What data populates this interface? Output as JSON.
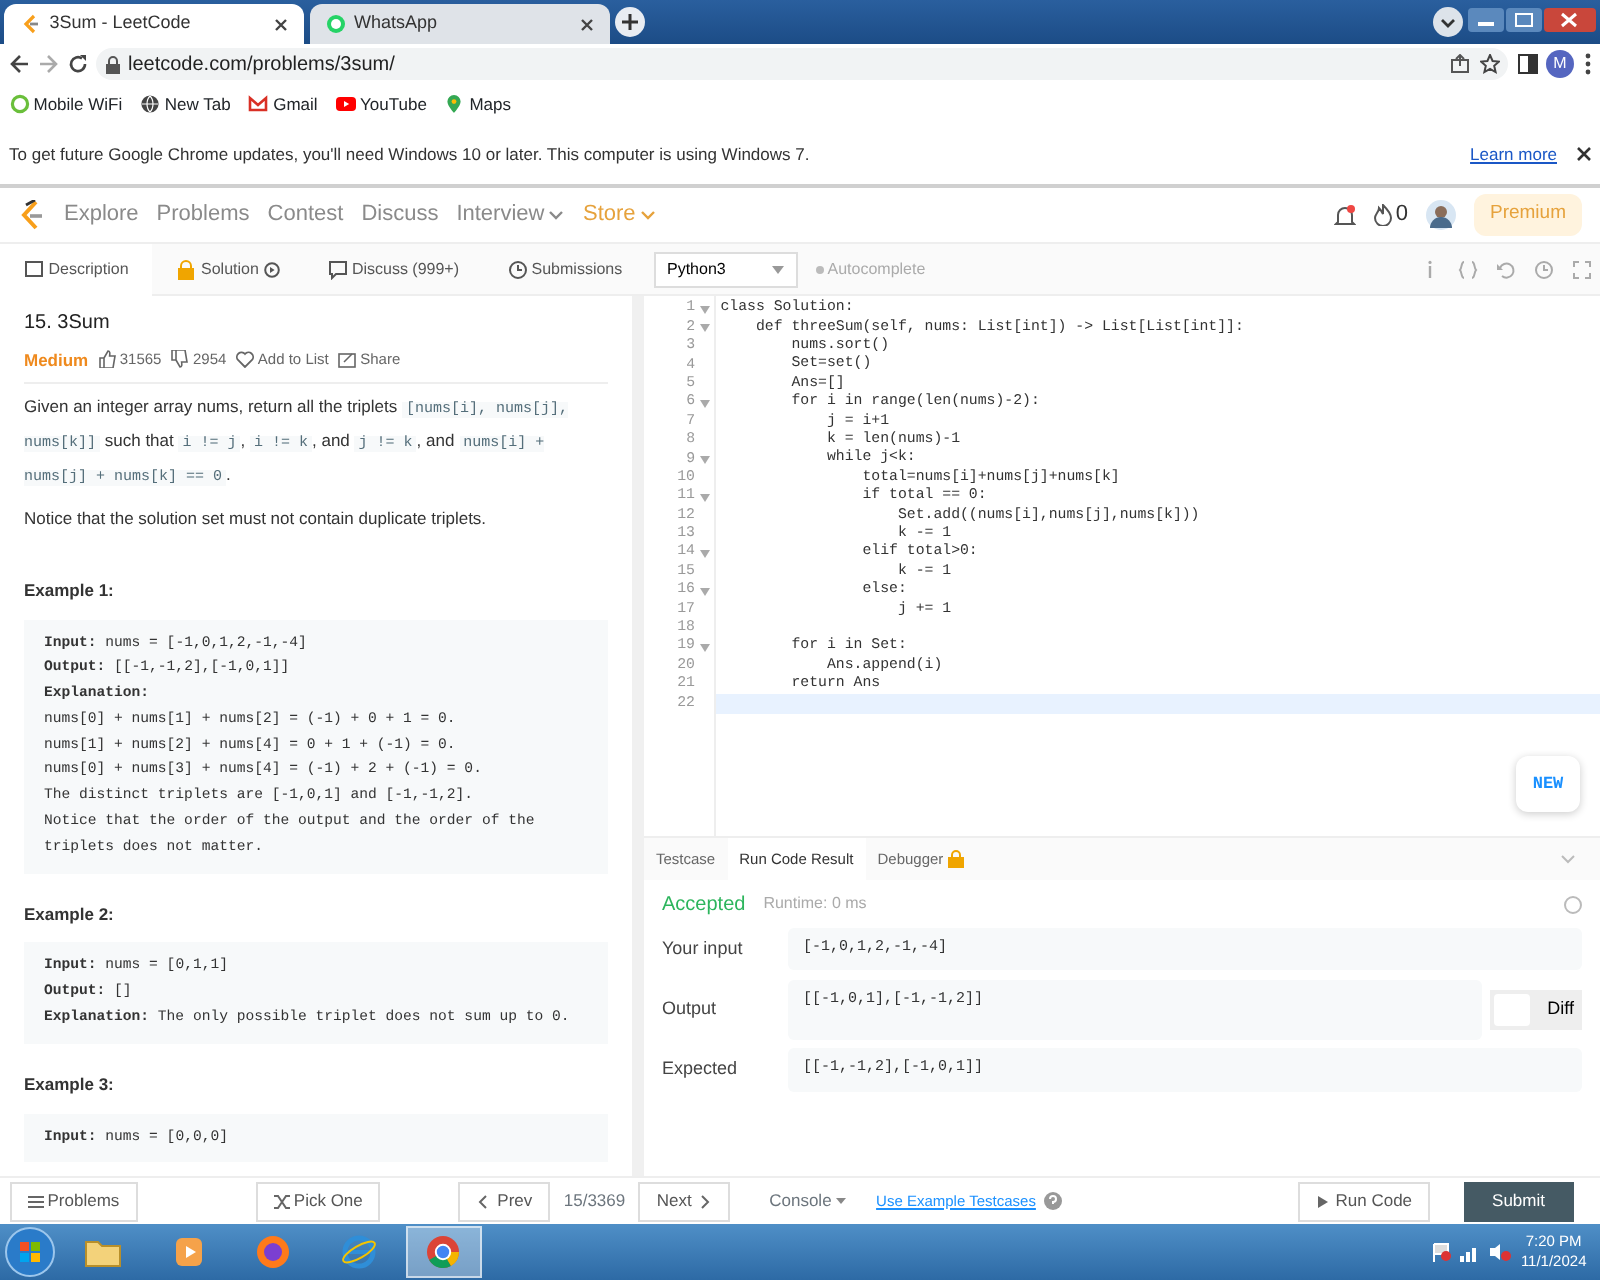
{
  "browser": {
    "tabs": [
      {
        "title": "3Sum - LeetCode",
        "selected": true,
        "kind": "leetcode"
      },
      {
        "title": "WhatsApp",
        "selected": false,
        "kind": "whatsapp"
      }
    ],
    "url": "leetcode.com/problems/3sum/",
    "profile": "M",
    "bookmarks": [
      {
        "label": "Mobile WiFi",
        "kind": "ring"
      },
      {
        "label": "New Tab",
        "kind": "globe"
      },
      {
        "label": "Gmail",
        "kind": "gmail"
      },
      {
        "label": "YouTube",
        "kind": "youtube"
      },
      {
        "label": "Maps",
        "kind": "maps"
      }
    ],
    "update_bar": {
      "message": "To get future Google Chrome updates, you'll need Windows 10 or later. This computer is using Windows 7.",
      "link": "Learn more"
    }
  },
  "nav": {
    "items": [
      {
        "label": "Explore",
        "kind": "plain"
      },
      {
        "label": "Problems",
        "kind": "plain"
      },
      {
        "label": "Contest",
        "kind": "plain"
      },
      {
        "label": "Discuss",
        "kind": "plain"
      },
      {
        "label": "Interview",
        "kind": "dropdown"
      },
      {
        "label": "Store",
        "kind": "store"
      }
    ],
    "streak": "0",
    "premium": "Premium"
  },
  "panel_tabs": [
    {
      "label": "Description",
      "selected": true,
      "kind": "doc"
    },
    {
      "label": "Solution",
      "selected": false,
      "kind": "lock"
    },
    {
      "label": "Discuss (999+)",
      "selected": false,
      "kind": "chat"
    },
    {
      "label": "Submissions",
      "selected": false,
      "kind": "clock"
    }
  ],
  "editor_toolbar": {
    "language": "Python3",
    "autocomplete": "Autocomplete"
  },
  "problem": {
    "title": "15. 3Sum",
    "difficulty": "Medium",
    "likes": "31565",
    "dislikes": "2954",
    "add_to_list": "Add to List",
    "share": "Share",
    "description": [
      {
        "kind": "text",
        "text": "Given an integer array nums, return all the triplets "
      },
      {
        "kind": "code",
        "text": "[nums[i], nums[j], nums[k]]"
      },
      {
        "kind": "text",
        "text": " such that "
      },
      {
        "kind": "code",
        "text": "i != j"
      },
      {
        "kind": "text",
        "text": ", "
      },
      {
        "kind": "code",
        "text": "i != k"
      },
      {
        "kind": "text",
        "text": ", and "
      },
      {
        "kind": "code",
        "text": "j != k"
      },
      {
        "kind": "text",
        "text": ", and "
      },
      {
        "kind": "code",
        "text": "nums[i] + nums[j] + nums[k] == 0"
      },
      {
        "kind": "text",
        "text": "."
      }
    ],
    "notice": "Notice that the solution set must not contain duplicate triplets.",
    "examples": [
      {
        "heading": "Example 1:",
        "lines": [
          "**Input:** nums = [-1,0,1,2,-1,-4]",
          "**Output:** [[-1,-1,2],[-1,0,1]]",
          "**Explanation:**",
          "nums[0] + nums[1] + nums[2] = (-1) + 0 + 1 = 0.",
          "nums[1] + nums[2] + nums[4] = 0 + 1 + (-1) = 0.",
          "nums[0] + nums[3] + nums[4] = (-1) + 2 + (-1) = 0.",
          "The distinct triplets are [-1,0,1] and [-1,-1,2].",
          "Notice that the order of the output and the order of the triplets does not matter."
        ]
      },
      {
        "heading": "Example 2:",
        "lines": [
          "**Input:** nums = [0,1,1]",
          "**Output:** []",
          "**Explanation:** The only possible triplet does not sum up to 0."
        ]
      },
      {
        "heading": "Example 3:",
        "lines": [
          "**Input:** nums = [0,0,0]"
        ]
      }
    ]
  },
  "code": [
    {
      "number": "1",
      "text": "class Solution:",
      "foldable": true,
      "current": false
    },
    {
      "number": "2",
      "text": "    def threeSum(self, nums: List[int]) -> List[List[int]]:",
      "foldable": true,
      "current": false
    },
    {
      "number": "3",
      "text": "        nums.sort()",
      "foldable": false,
      "current": false
    },
    {
      "number": "4",
      "text": "        Set=set()",
      "foldable": false,
      "current": false
    },
    {
      "number": "5",
      "text": "        Ans=[]",
      "foldable": false,
      "current": false
    },
    {
      "number": "6",
      "text": "        for i in range(len(nums)-2):",
      "foldable": true,
      "current": false
    },
    {
      "number": "7",
      "text": "            j = i+1",
      "foldable": false,
      "current": false
    },
    {
      "number": "8",
      "text": "            k = len(nums)-1",
      "foldable": false,
      "current": false
    },
    {
      "number": "9",
      "text": "            while j<k:",
      "foldable": true,
      "current": false
    },
    {
      "number": "10",
      "text": "                total=nums[i]+nums[j]+nums[k]",
      "foldable": false,
      "current": false
    },
    {
      "number": "11",
      "text": "                if total == 0:",
      "foldable": true,
      "current": false
    },
    {
      "number": "12",
      "text": "                    Set.add((nums[i],nums[j],nums[k]))",
      "foldable": false,
      "current": false
    },
    {
      "number": "13",
      "text": "                    k -= 1",
      "foldable": false,
      "current": false
    },
    {
      "number": "14",
      "text": "                elif total>0:",
      "foldable": true,
      "current": false
    },
    {
      "number": "15",
      "text": "                    k -= 1",
      "foldable": false,
      "current": false
    },
    {
      "number": "16",
      "text": "                else:",
      "foldable": true,
      "current": false
    },
    {
      "number": "17",
      "text": "                    j += 1",
      "foldable": false,
      "current": false
    },
    {
      "number": "18",
      "foldable": false,
      "current": false
    },
    {
      "number": "19",
      "text": "        for i in Set:",
      "foldable": true,
      "current": false
    },
    {
      "number": "20",
      "text": "            Ans.append(i)",
      "foldable": false,
      "current": false
    },
    {
      "number": "21",
      "text": "        return Ans",
      "foldable": false,
      "current": false
    },
    {
      "number": "22",
      "foldable": false,
      "current": true
    }
  ],
  "new_badge": "NEW",
  "console_tabs": [
    {
      "label": "Testcase",
      "selected": false,
      "locked": false
    },
    {
      "label": "Run Code Result",
      "selected": true,
      "locked": false
    },
    {
      "label": "Debugger",
      "selected": false,
      "locked": true
    }
  ],
  "result": {
    "status": "Accepted",
    "runtime": "Runtime: 0 ms",
    "rows": [
      {
        "label": "Your input",
        "value": "[-1,0,1,2,-1,-4]",
        "kind": "plain"
      },
      {
        "label": "Output",
        "value": "[[-1,0,1],[-1,-1,2]]",
        "kind": "diff"
      },
      {
        "label": "Expected",
        "value": "[[-1,-1,2],[-1,0,1]]",
        "kind": "plain"
      }
    ],
    "diff_label": "Diff",
    "diff_on": false
  },
  "footer": {
    "problems": "Problems",
    "pick_one": "Pick One",
    "prev": "Prev",
    "counter": "15/3369",
    "next": "Next",
    "console": "Console",
    "use_example": "Use Example Testcases",
    "run_code": "Run Code",
    "submit": "Submit"
  },
  "taskbar": {
    "apps": [
      {
        "kind": "folder",
        "selected": false
      },
      {
        "kind": "media",
        "selected": false
      },
      {
        "kind": "firefox",
        "selected": false
      },
      {
        "kind": "ie",
        "selected": false
      },
      {
        "kind": "chrome",
        "selected": true
      }
    ],
    "time": "7:20 PM",
    "date": "11/1/2024"
  }
}
